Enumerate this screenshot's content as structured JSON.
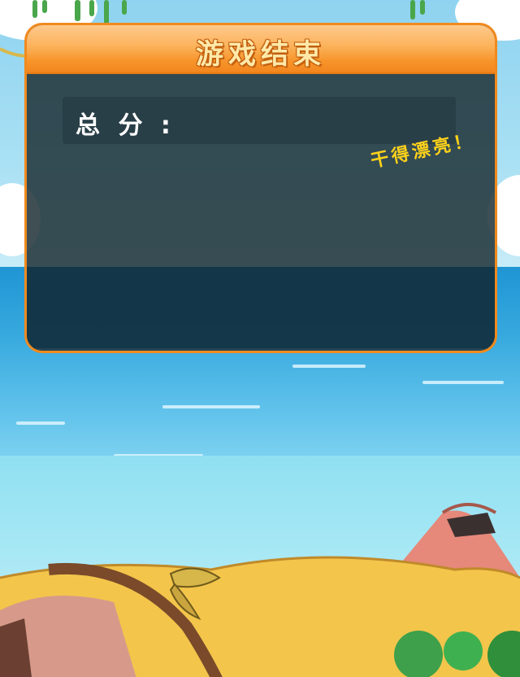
{
  "dialog": {
    "title": "游戏结束",
    "score_label": "总 分 :",
    "praise": "干得漂亮！"
  },
  "colors": {
    "panel_border": "#f08a1e",
    "header_top": "#ffc98d",
    "header_bottom": "#f2861e",
    "title_text": "#ffe9a8",
    "praise_text": "#ffd21a",
    "panel_fill": "#203238"
  },
  "scene": {
    "background": "tropical-island-beach",
    "elements": [
      "sky",
      "clouds",
      "hanging-vines",
      "sea",
      "volcano",
      "palm-tree",
      "sand-dunes",
      "shrubs"
    ]
  }
}
